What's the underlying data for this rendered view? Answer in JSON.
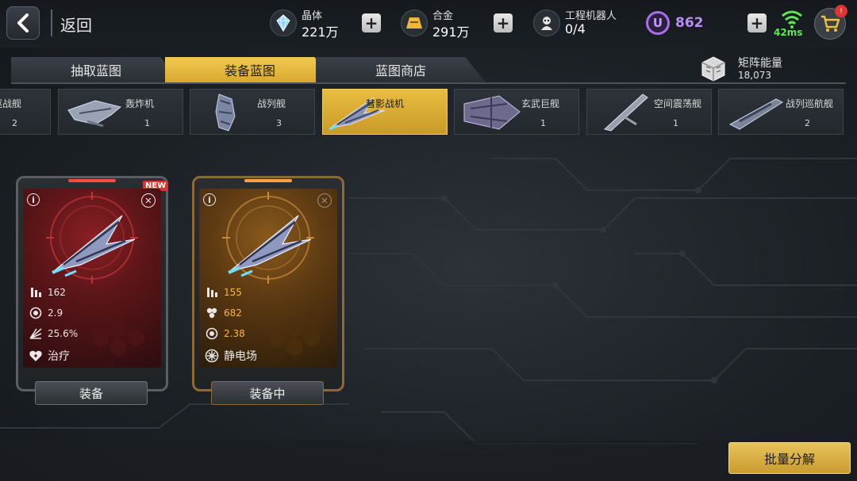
{
  "header": {
    "back_label": "返回",
    "resources": [
      {
        "name": "晶体",
        "value": "221万",
        "icon": "crystal-icon"
      },
      {
        "name": "合金",
        "value": "291万",
        "icon": "alloy-icon"
      },
      {
        "name": "工程机器人",
        "value": "0/4",
        "icon": "robot-icon"
      }
    ],
    "u_currency": {
      "icon_letter": "U",
      "value": "862"
    },
    "ping": "42ms",
    "cart_badge": "!"
  },
  "tabs": [
    {
      "label": "抽取蓝图",
      "active": false
    },
    {
      "label": "装备蓝图",
      "active": true
    },
    {
      "label": "蓝图商店",
      "active": false
    }
  ],
  "matrix_energy": {
    "label": "矩阵能量",
    "value": "18,073"
  },
  "ships": [
    {
      "name": "驱战舰",
      "count": "2",
      "active": false
    },
    {
      "name": "轰炸机",
      "count": "1",
      "active": false
    },
    {
      "name": "战列舰",
      "count": "3",
      "active": false
    },
    {
      "name": "彗影战机",
      "count": "",
      "active": true
    },
    {
      "name": "玄武巨舰",
      "count": "1",
      "active": false
    },
    {
      "name": "空间震荡舰",
      "count": "1",
      "active": false
    },
    {
      "name": "战列巡航舰",
      "count": "2",
      "active": false
    }
  ],
  "cards": [
    {
      "theme": "red",
      "badge": "NEW",
      "stats": [
        {
          "icon": "ammo-icon",
          "value": "162"
        },
        {
          "icon": "rate-icon",
          "value": "2.9"
        },
        {
          "icon": "spread-icon",
          "value": "25.6%"
        }
      ],
      "skill": {
        "icon": "heal-icon",
        "label": "治疗"
      },
      "button": "装备"
    },
    {
      "theme": "gold",
      "badge": "",
      "stats": [
        {
          "icon": "ammo-icon",
          "value": "155"
        },
        {
          "icon": "hex-icon",
          "value": "682"
        },
        {
          "icon": "rate-icon",
          "value": "2.38"
        }
      ],
      "skill": {
        "icon": "static-field-icon",
        "label": "静电场"
      },
      "button": "装备中"
    }
  ],
  "bulk_button": "批量分解",
  "colors": {
    "accent": "#e6b840",
    "red_card": "#6b1a1e",
    "gold_card": "#6d4515",
    "u_purple": "#a870e8",
    "ping_green": "#5ee84f"
  }
}
